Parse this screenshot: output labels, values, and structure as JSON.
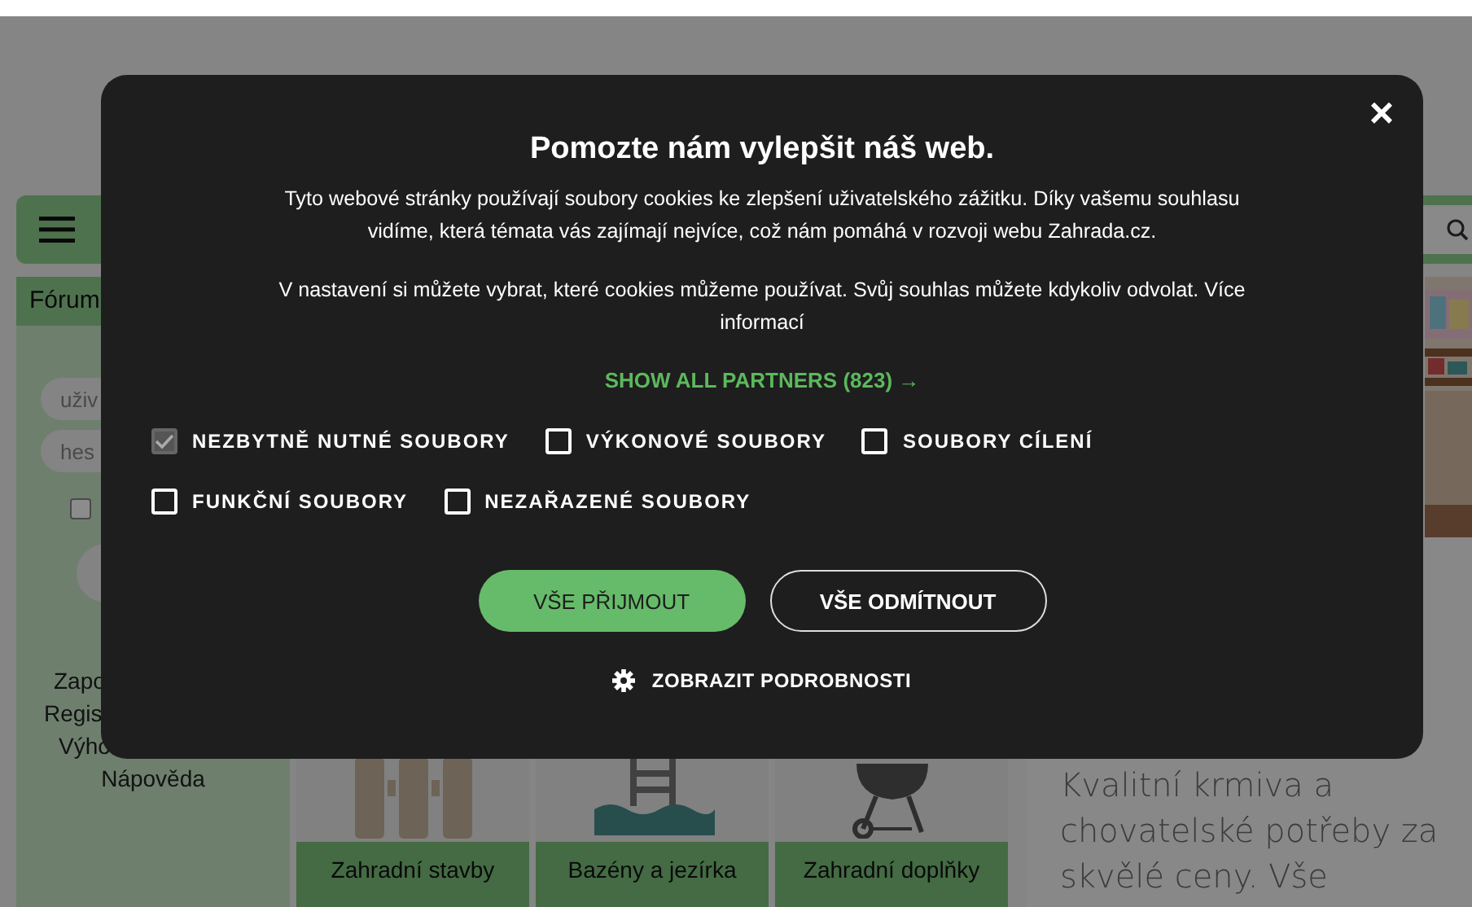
{
  "site": {
    "forum_tab": "Fórum",
    "username_placeholder": "uživ",
    "password_placeholder": "hes",
    "remember_checked": false,
    "links": [
      "Zapo",
      "Regis",
      "Výho",
      "Nápověda"
    ],
    "categories": [
      {
        "label": "Zahradní stavby",
        "kind": "fence"
      },
      {
        "label": "Bazény a jezírka",
        "kind": "pool"
      },
      {
        "label": "Zahradní doplňky",
        "kind": "grill"
      }
    ],
    "promo": "Kvalitní krmiva a chovatelské potřeby za skvělé ceny. Vše"
  },
  "cookie_dialog": {
    "close": "×",
    "title": "Pomozte nám vylepšit náš web.",
    "paragraphs": [
      "Tyto webové stránky používají soubory cookies ke zlepšení uživatelského zážitku. Díky vašemu souhlasu vidíme, která témata vás zajímají nejvíce, což nám pomáhá v rozvoji webu Zahrada.cz.",
      "V nastavení si můžete vybrat, které cookies můžeme používat. Svůj souhlas můžete kdykoliv odvolat. Více informací"
    ],
    "partners_link": "SHOW ALL PARTNERS (823) →",
    "option_rows": [
      [
        {
          "label": "NEZBYTNĚ NUTNÉ SOUBORY",
          "checked": true,
          "disabled": true
        },
        {
          "label": "VÝKONOVÉ SOUBORY",
          "checked": false,
          "disabled": false
        },
        {
          "label": "SOUBORY CÍLENÍ",
          "checked": false,
          "disabled": false
        }
      ],
      [
        {
          "label": "FUNKČNÍ SOUBORY",
          "checked": false,
          "disabled": false
        },
        {
          "label": "NEZAŘAZENÉ SOUBORY",
          "checked": false,
          "disabled": false
        }
      ]
    ],
    "accept_button": "VŠE PŘIJMOUT",
    "reject_button": "VŠE ODMÍTNOUT",
    "details_link": "ZOBRAZIT PODROBNOSTI"
  }
}
